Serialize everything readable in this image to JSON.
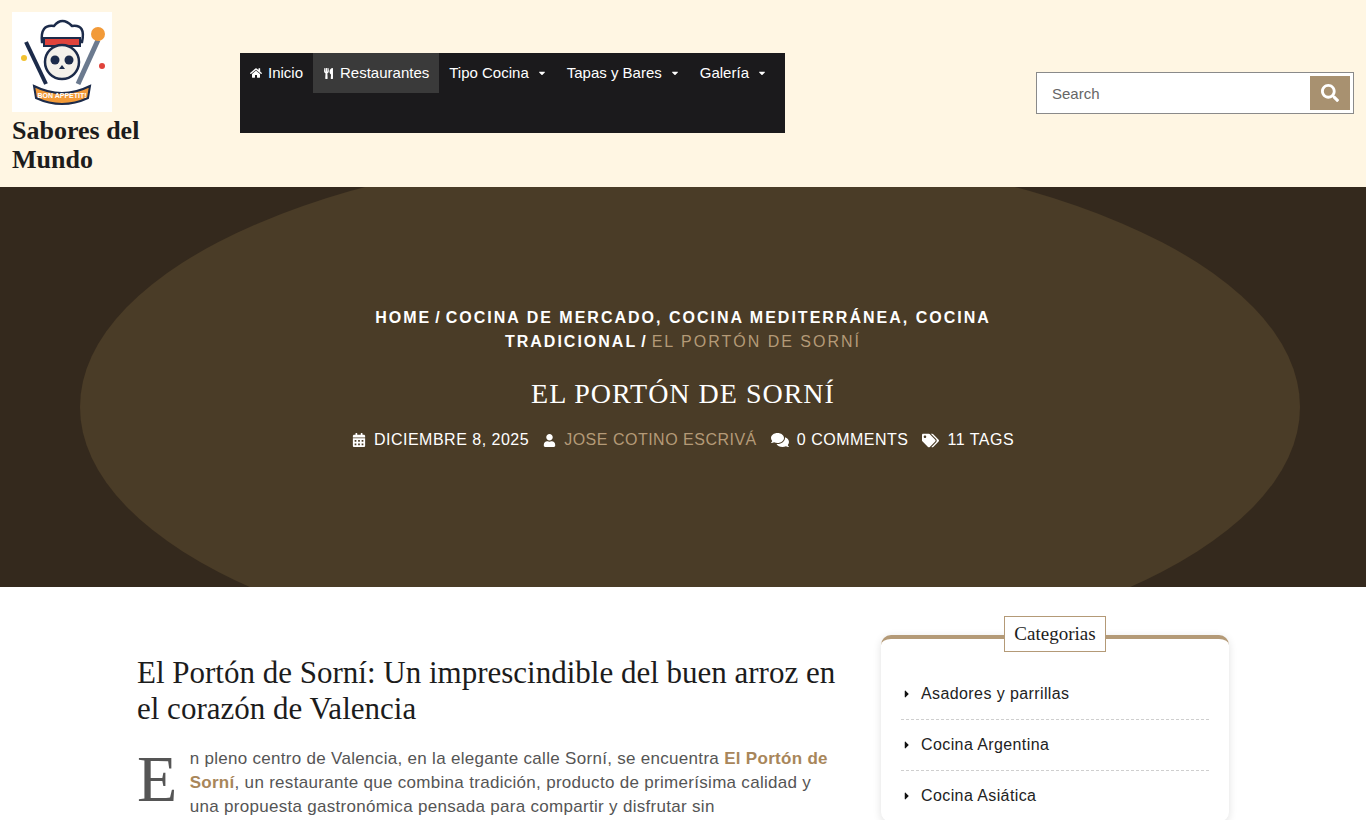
{
  "site": {
    "title": "Sabores del Mundo",
    "logo_text": "BON APPETIT!"
  },
  "nav": [
    {
      "label": "Inicio",
      "icon": "home",
      "dropdown": false,
      "selected": false
    },
    {
      "label": "Restaurantes",
      "icon": "utensils",
      "dropdown": false,
      "selected": true
    },
    {
      "label": "Tipo Cocina",
      "icon": "none",
      "dropdown": true,
      "selected": false
    },
    {
      "label": "Tapas y Bares",
      "icon": "none",
      "dropdown": true,
      "selected": false
    },
    {
      "label": "Galería",
      "icon": "none",
      "dropdown": true,
      "selected": false
    }
  ],
  "search": {
    "placeholder": "Search"
  },
  "hero": {
    "breadcrumb": [
      {
        "label": "HOME",
        "current": false
      },
      {
        "label": "COCINA DE MERCADO, COCINA MEDITERRÁNEA, COCINA TRADICIONAL",
        "current": false
      },
      {
        "label": "EL PORTÓN DE SORNÍ",
        "current": true
      }
    ],
    "separator": "/",
    "title": "EL PORTÓN DE SORNÍ",
    "meta": {
      "date": "DICIEMBRE 8, 2025",
      "author": "JOSE COTINO ESCRIVÁ",
      "comments": "0 COMMENTS",
      "tags": "11 TAGS"
    }
  },
  "article": {
    "heading": "El Portón de Sorní: Un imprescindible del buen arroz en el corazón de Valencia",
    "drop_cap": "E",
    "paragraph": [
      {
        "text": "n pleno centro de Valencia, en la elegante calle Sorní, se encuentra ",
        "bold": false
      },
      {
        "text": "El Portón de Sorní",
        "bold": true
      },
      {
        "text": ", un restaurante que combina tradición, producto de primerísima calidad y una propuesta gastronómica pensada para compartir y disfrutar sin",
        "bold": false
      }
    ]
  },
  "sidebar": {
    "title": "Categorias",
    "items": [
      "Asadores y parrillas",
      "Cocina Argentina",
      "Cocina Asiática"
    ]
  }
}
